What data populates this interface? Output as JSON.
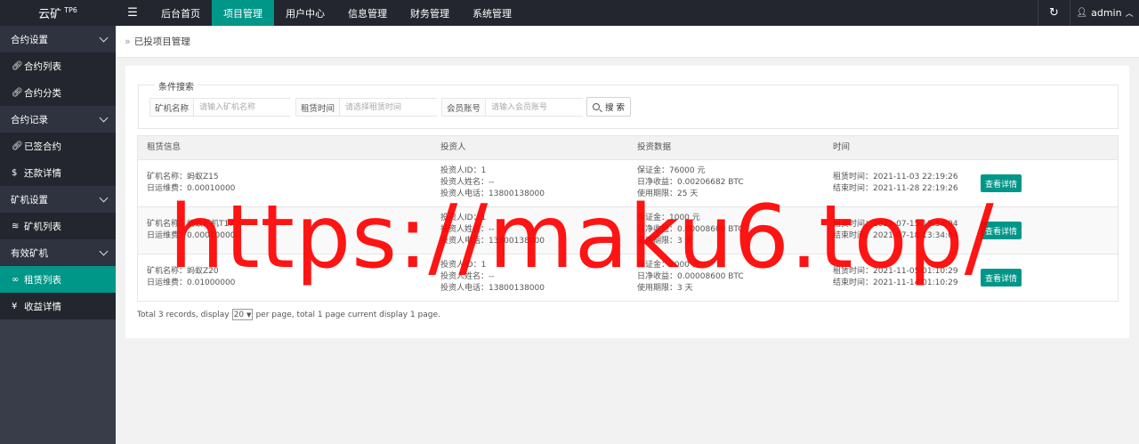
{
  "app": {
    "logo": "云矿",
    "logo_sup": "TP6"
  },
  "topnav": {
    "items": [
      {
        "label": "后台首页",
        "active": false
      },
      {
        "label": "项目管理",
        "active": true
      },
      {
        "label": "用户中心",
        "active": false
      },
      {
        "label": "信息管理",
        "active": false
      },
      {
        "label": "财务管理",
        "active": false
      },
      {
        "label": "系统管理",
        "active": false
      }
    ],
    "user": "admin"
  },
  "sidebar": {
    "groups": [
      {
        "label": "合约设置",
        "items": [
          {
            "label": "合约列表",
            "icon": "link-icon"
          },
          {
            "label": "合约分类",
            "icon": "link-icon"
          }
        ]
      },
      {
        "label": "合约记录",
        "items": [
          {
            "label": "已签合约",
            "icon": "link-icon"
          },
          {
            "label": "还款详情",
            "icon": "dollar-icon"
          }
        ]
      },
      {
        "label": "矿机设置",
        "items": [
          {
            "label": "矿机列表",
            "icon": "layers-icon"
          }
        ]
      },
      {
        "label": "有效矿机",
        "items": [
          {
            "label": "租赁列表",
            "icon": "infinity-icon",
            "active": true
          },
          {
            "label": "收益详情",
            "icon": "yen-icon"
          }
        ]
      }
    ]
  },
  "breadcrumb": "已投项目管理",
  "search": {
    "legend": "条件搜索",
    "fields": [
      {
        "label": "矿机名称",
        "placeholder": "请输入矿机名称"
      },
      {
        "label": "租赁时间",
        "placeholder": "请选择租赁时间"
      },
      {
        "label": "会员账号",
        "placeholder": "请输入会员账号"
      }
    ],
    "button": "搜 索"
  },
  "table": {
    "headers": [
      "租赁信息",
      "投资人",
      "投资数据",
      "时间"
    ],
    "rows": [
      {
        "info": [
          "矿机名称：蚂蚁Z15",
          "日运维费：0.00010000"
        ],
        "investor": [
          "投资人ID：1",
          "投资人姓名：--",
          "投资人电话：13800138000"
        ],
        "data": [
          "保证金：76000 元",
          "日净收益：0.00206682 BTC",
          "使用期限：25 天"
        ],
        "time": [
          "租赁时间：2021-11-03 22:19:26",
          "结束时间：2021-11-28 22:19:26"
        ],
        "action": "查看详情"
      },
      {
        "info": [
          "矿机名称：蚂蚁矿机T17",
          "日运维费：0.00010000"
        ],
        "investor": [
          "投资人ID：1",
          "投资人姓名：--",
          "投资人电话：13800138000"
        ],
        "data": [
          "保证金：1000 元",
          "日净收益：0.00008600 BTC",
          "使用期限：3 天"
        ],
        "time": [
          "租赁时间：2021-07-15 13:34:04",
          "结束时间：2021-07-18 13:34:04"
        ],
        "action": "查看详情"
      },
      {
        "info": [
          "矿机名称：蚂蚁Z20",
          "日运维费：0.01000000"
        ],
        "investor": [
          "投资人ID：1",
          "投资人姓名：--",
          "投资人电话：13800138000"
        ],
        "data": [
          "保证金：2000 元",
          "日净收益：0.00008600 BTC",
          "使用期限：3 天"
        ],
        "time": [
          "租赁时间：2021-11-05 01:10:29",
          "结束时间：2021-11-14 01:10:29"
        ],
        "action": "查看详情"
      }
    ]
  },
  "pager": {
    "before": "Total 3 records, display",
    "per_page": "20",
    "after": "per page, total 1 page current display 1 page."
  },
  "watermark": "https://maku6.top/"
}
